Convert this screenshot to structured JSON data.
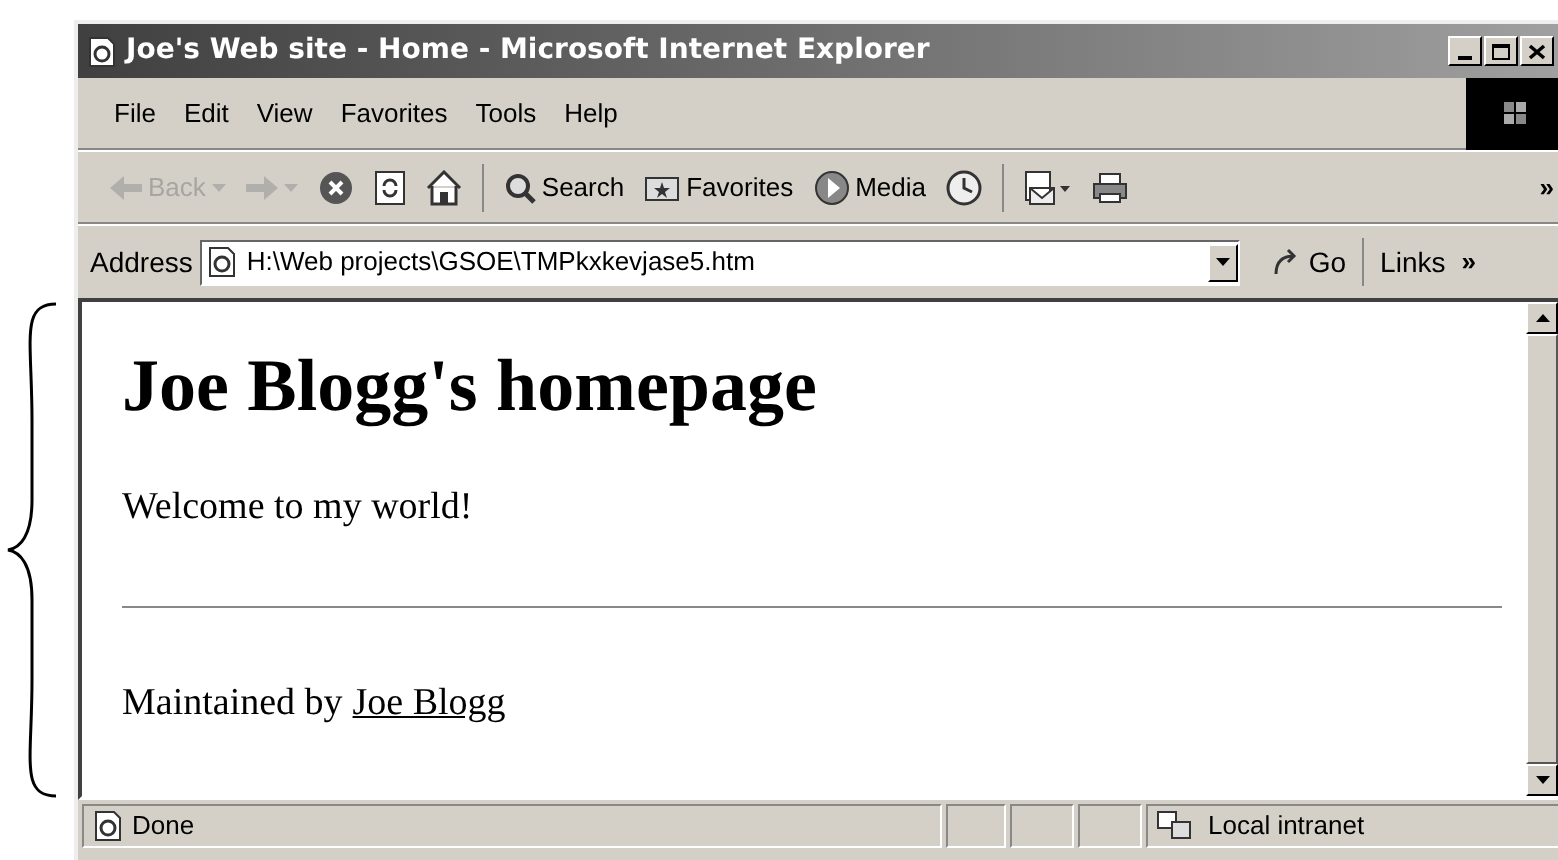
{
  "window": {
    "title": "Joe's Web site - Home - Microsoft Internet Explorer"
  },
  "menu": [
    "File",
    "Edit",
    "View",
    "Favorites",
    "Tools",
    "Help"
  ],
  "toolbar": [
    {
      "kind": "back",
      "label": "Back",
      "disabled": true
    },
    {
      "kind": "forward",
      "disabled": true
    },
    {
      "kind": "stop",
      "disabled": false
    },
    {
      "kind": "refresh",
      "disabled": false
    },
    {
      "kind": "home",
      "disabled": false
    },
    {
      "kind": "search",
      "label": "Search",
      "disabled": false
    },
    {
      "kind": "favorites",
      "label": "Favorites",
      "disabled": false
    },
    {
      "kind": "media",
      "label": "Media",
      "disabled": false
    },
    {
      "kind": "history",
      "disabled": false
    },
    {
      "kind": "mail",
      "disabled": false
    },
    {
      "kind": "print",
      "disabled": false
    }
  ],
  "toolbar_more": "»",
  "address": {
    "label": "Address",
    "value": "H:\\Web projects\\GSOE\\TMPkxkevjase5.htm",
    "go": "Go",
    "links": "Links",
    "more": "»"
  },
  "page": {
    "heading": "Joe Blogg's homepage",
    "paragraph": "Welcome to my world!",
    "footer": "Maintained by",
    "link": "Joe Blogg"
  },
  "status_bar": {
    "text": "Done",
    "zone": "Local intranet"
  }
}
